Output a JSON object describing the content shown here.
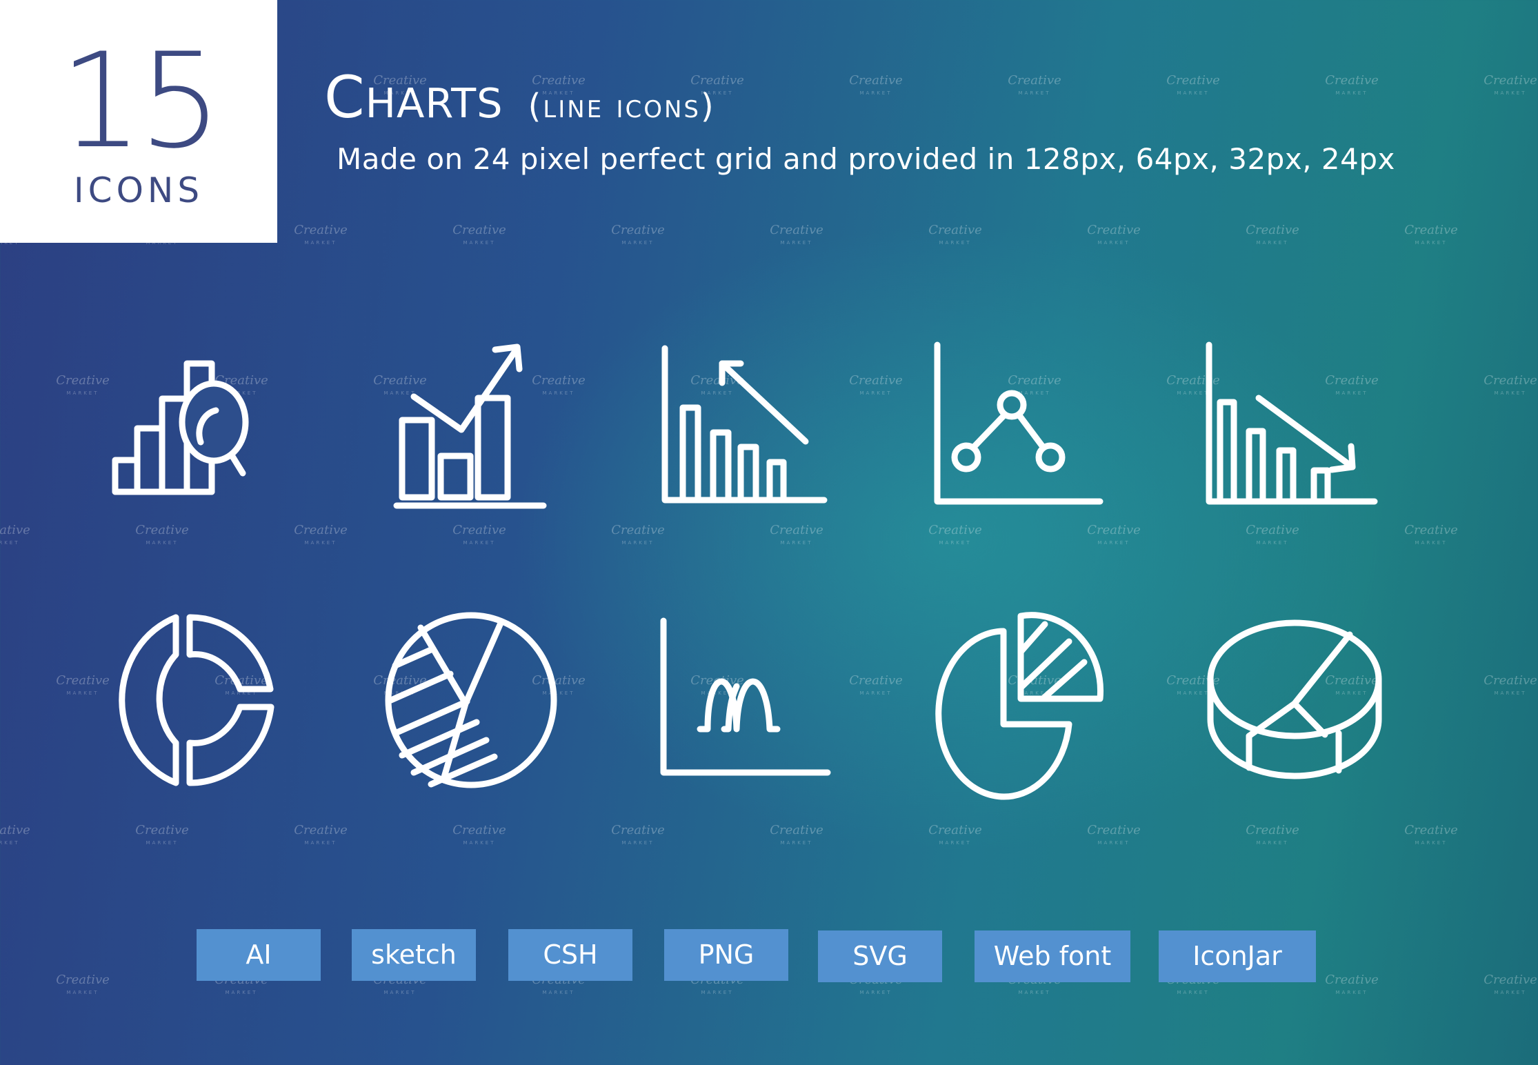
{
  "badge": {
    "count": "15",
    "label": "ICONS"
  },
  "header": {
    "title": "Charts",
    "title_suffix": "(line icons)",
    "subtitle": "Made on 24 pixel perfect grid and provided in 128px, 64px, 32px, 24px"
  },
  "colors": {
    "badge_background": "#ffffff",
    "badge_text": "#3d4a82",
    "background_left": "#2c3f82",
    "background_right": "#1f7f84",
    "icon_stroke": "#ffffff",
    "format_button": "#5391d0"
  },
  "icons": [
    {
      "name": "bar-chart-magnifier-icon"
    },
    {
      "name": "bar-chart-trend-up-icon"
    },
    {
      "name": "bar-chart-arrow-up-left-icon"
    },
    {
      "name": "line-chart-points-icon"
    },
    {
      "name": "bar-chart-trend-down-icon"
    },
    {
      "name": "donut-chart-icon"
    },
    {
      "name": "pie-chart-hatched-icon"
    },
    {
      "name": "bell-curve-chart-icon"
    },
    {
      "name": "pie-chart-exploded-slice-icon"
    },
    {
      "name": "3d-pie-chart-icon"
    }
  ],
  "formats": [
    "AI",
    "sketch",
    "CSH",
    "PNG",
    "SVG",
    "Web font",
    "IconJar"
  ],
  "watermark": {
    "text": "Creative",
    "subtext": "MARKET"
  }
}
